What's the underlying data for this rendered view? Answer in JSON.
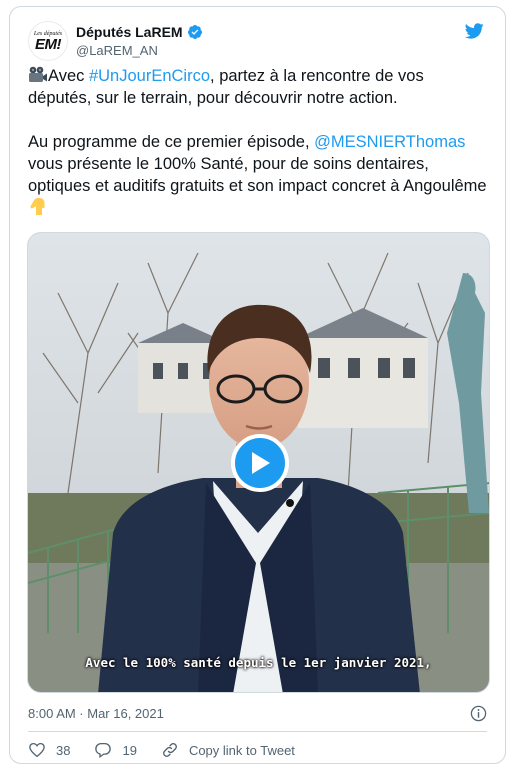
{
  "account": {
    "display_name": "Députés LaREM",
    "handle": "@LaREM_AN",
    "avatar_line1": "Les députés",
    "avatar_line2": "EM!",
    "verified": true
  },
  "tweet": {
    "line1_pre": "Avec ",
    "hashtag": "#UnJourEnCirco",
    "line1_post": ", partez à la rencontre de vos députés, sur le terrain, pour découvrir notre action.",
    "line2_pre": "Au programme de ce premier épisode, ",
    "mention": "@MESNIERThomas",
    "line2_post": " vous présente le 100% Santé, pour de soins dentaires, optiques et auditifs gratuits et son impact concret à Angoulême "
  },
  "media": {
    "subtitle": "Avec le 100% santé depuis le 1er janvier 2021,"
  },
  "footer": {
    "timestamp": "8:00 AM · Mar 16, 2021",
    "likes": "38",
    "replies": "19",
    "copy_link_label": "Copy link to Tweet"
  },
  "colors": {
    "accent": "#1d9bf0",
    "text": "#0f1419",
    "secondary": "#536471",
    "border": "#cfd9de"
  }
}
